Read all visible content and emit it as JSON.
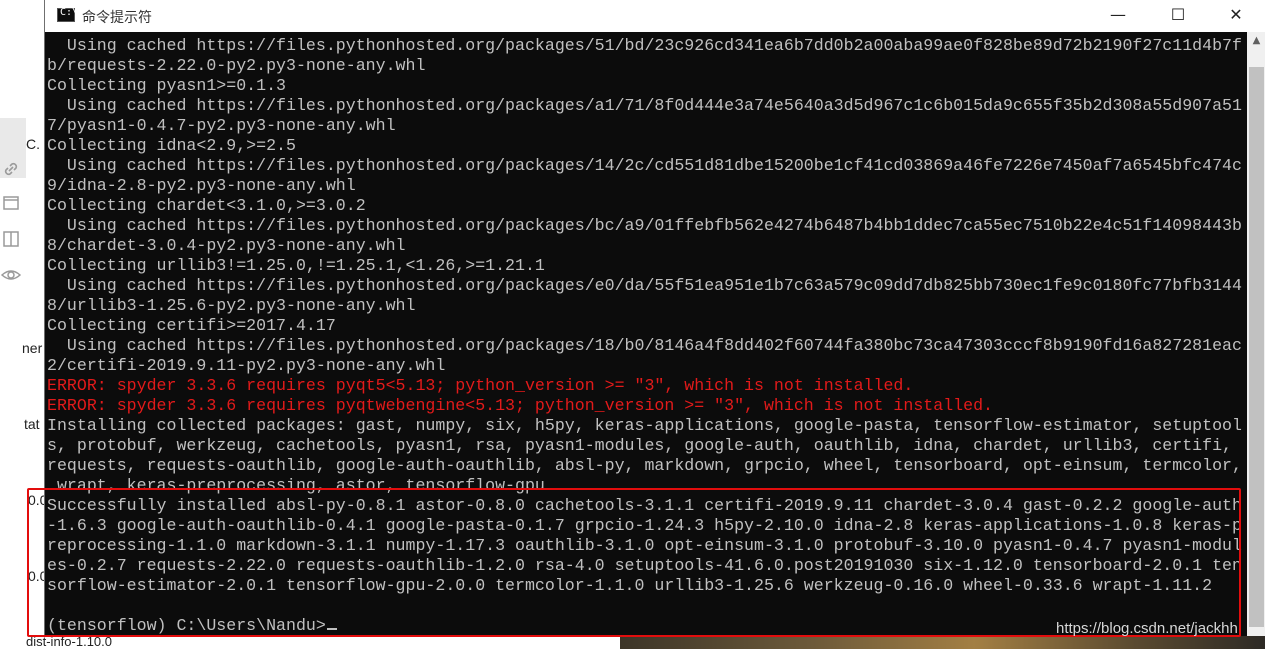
{
  "background": {
    "left_fragments": [
      "C.",
      "ner",
      "tat",
      "0.0",
      "0.0"
    ],
    "bottom_fragment": "dist-info-1.10.0"
  },
  "window": {
    "title": "命令提示符",
    "icon_text": "C:\\",
    "controls": {
      "minimize": "—",
      "maximize": "☐",
      "close": "✕"
    }
  },
  "console": {
    "lines": [
      {
        "text": "  Using cached https://files.pythonhosted.org/packages/51/bd/23c926cd341ea6b7dd0b2a00aba99ae0f828be89d72b2190f27c11d4b7f",
        "type": "normal"
      },
      {
        "text": "b/requests-2.22.0-py2.py3-none-any.whl",
        "type": "normal"
      },
      {
        "text": "Collecting pyasn1>=0.1.3",
        "type": "normal"
      },
      {
        "text": "  Using cached https://files.pythonhosted.org/packages/a1/71/8f0d444e3a74e5640a3d5d967c1c6b015da9c655f35b2d308a55d907a51",
        "type": "normal"
      },
      {
        "text": "7/pyasn1-0.4.7-py2.py3-none-any.whl",
        "type": "normal"
      },
      {
        "text": "Collecting idna<2.9,>=2.5",
        "type": "normal"
      },
      {
        "text": "  Using cached https://files.pythonhosted.org/packages/14/2c/cd551d81dbe15200be1cf41cd03869a46fe7226e7450af7a6545bfc474c",
        "type": "normal"
      },
      {
        "text": "9/idna-2.8-py2.py3-none-any.whl",
        "type": "normal"
      },
      {
        "text": "Collecting chardet<3.1.0,>=3.0.2",
        "type": "normal"
      },
      {
        "text": "  Using cached https://files.pythonhosted.org/packages/bc/a9/01ffebfb562e4274b6487b4bb1ddec7ca55ec7510b22e4c51f14098443b",
        "type": "normal"
      },
      {
        "text": "8/chardet-3.0.4-py2.py3-none-any.whl",
        "type": "normal"
      },
      {
        "text": "Collecting urllib3!=1.25.0,!=1.25.1,<1.26,>=1.21.1",
        "type": "normal"
      },
      {
        "text": "  Using cached https://files.pythonhosted.org/packages/e0/da/55f51ea951e1b7c63a579c09dd7db825bb730ec1fe9c0180fc77bfb3144",
        "type": "normal"
      },
      {
        "text": "8/urllib3-1.25.6-py2.py3-none-any.whl",
        "type": "normal"
      },
      {
        "text": "Collecting certifi>=2017.4.17",
        "type": "normal"
      },
      {
        "text": "  Using cached https://files.pythonhosted.org/packages/18/b0/8146a4f8dd402f60744fa380bc73ca47303cccf8b9190fd16a827281eac",
        "type": "normal"
      },
      {
        "text": "2/certifi-2019.9.11-py2.py3-none-any.whl",
        "type": "normal"
      },
      {
        "text": "ERROR: spyder 3.3.6 requires pyqt5<5.13; python_version >= \"3\", which is not installed.",
        "type": "error"
      },
      {
        "text": "ERROR: spyder 3.3.6 requires pyqtwebengine<5.13; python_version >= \"3\", which is not installed.",
        "type": "error"
      },
      {
        "text": "Installing collected packages: gast, numpy, six, h5py, keras-applications, google-pasta, tensorflow-estimator, setuptool",
        "type": "normal"
      },
      {
        "text": "s, protobuf, werkzeug, cachetools, pyasn1, rsa, pyasn1-modules, google-auth, oauthlib, idna, chardet, urllib3, certifi,",
        "type": "normal"
      },
      {
        "text": "requests, requests-oauthlib, google-auth-oauthlib, absl-py, markdown, grpcio, wheel, tensorboard, opt-einsum, termcolor,",
        "type": "normal"
      },
      {
        "text": " wrapt, keras-preprocessing, astor, tensorflow-gpu",
        "type": "normal"
      },
      {
        "text": "Successfully installed absl-py-0.8.1 astor-0.8.0 cachetools-3.1.1 certifi-2019.9.11 chardet-3.0.4 gast-0.2.2 google-auth",
        "type": "normal"
      },
      {
        "text": "-1.6.3 google-auth-oauthlib-0.4.1 google-pasta-0.1.7 grpcio-1.24.3 h5py-2.10.0 idna-2.8 keras-applications-1.0.8 keras-p",
        "type": "normal"
      },
      {
        "text": "reprocessing-1.1.0 markdown-3.1.1 numpy-1.17.3 oauthlib-3.1.0 opt-einsum-3.1.0 protobuf-3.10.0 pyasn1-0.4.7 pyasn1-modul",
        "type": "normal"
      },
      {
        "text": "es-0.2.7 requests-2.22.0 requests-oauthlib-1.2.0 rsa-4.0 setuptools-41.6.0.post20191030 six-1.12.0 tensorboard-2.0.1 ten",
        "type": "normal"
      },
      {
        "text": "sorflow-estimator-2.0.1 tensorflow-gpu-2.0.0 termcolor-1.1.0 urllib3-1.25.6 werkzeug-0.16.0 wheel-0.33.6 wrapt-1.11.2",
        "type": "normal"
      },
      {
        "text": "",
        "type": "normal"
      },
      {
        "text": "(tensorflow) C:\\Users\\Nandu>",
        "type": "prompt"
      }
    ]
  },
  "watermark": "https://blog.csdn.net/jackhh"
}
